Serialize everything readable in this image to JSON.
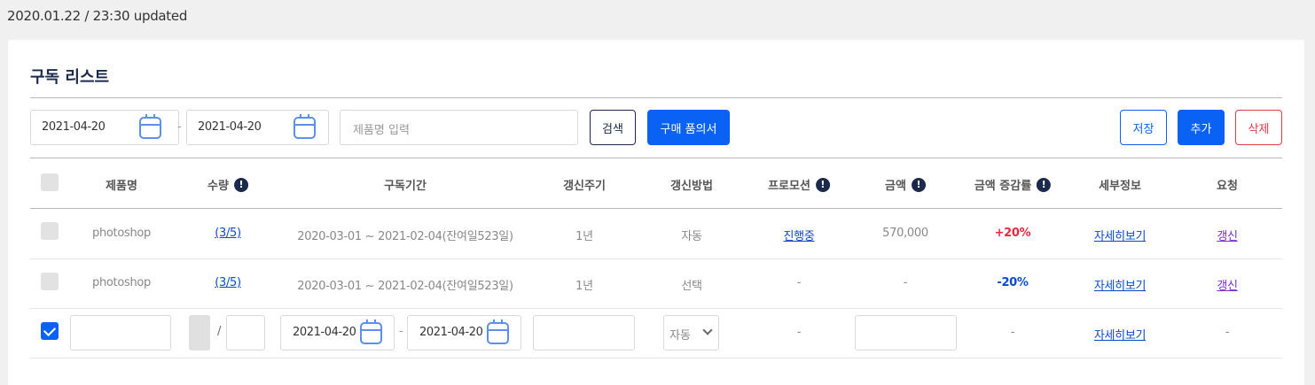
{
  "header": {
    "updated": "2020.01.22 / 23:30 updated"
  },
  "card": {
    "title": "구독 리스트"
  },
  "filters": {
    "start_date": "2021-04-20",
    "end_date": "2021-04-20",
    "separator": "-",
    "product_placeholder": "제품명 입력",
    "search_label": "검색",
    "purchase_label": "구매 품의서",
    "save_label": "저장",
    "add_label": "추가",
    "delete_label": "삭제"
  },
  "columns": [
    "제품명",
    "수량",
    "구독기간",
    "갱신주기",
    "갱신방법",
    "프로모션",
    "금액",
    "금액 증감률",
    "세부정보",
    "요청"
  ],
  "info_icon": "!",
  "rows": [
    {
      "product": "photoshop",
      "quantity": "(3/5)",
      "period": "2020-03-01 ~ 2021-02-04(잔여일523일)",
      "cycle": "1년",
      "method": "자동",
      "promotion": "진행중",
      "amount": "570,000",
      "change": "+20%",
      "details": "자세히보기",
      "request": "갱신"
    },
    {
      "product": "photoshop",
      "quantity": "(3/5)",
      "period": "2020-03-01 ~ 2021-02-04(잔여일523일)",
      "cycle": "1년",
      "method": "선택",
      "promotion": "-",
      "amount": "-",
      "change": "-20%",
      "details": "자세히보기",
      "request": "갱신"
    }
  ],
  "edit_row": {
    "slash": "/",
    "start_date": "2021-04-20",
    "end_date": "2021-04-20",
    "date_sep": "-",
    "method": "자동",
    "promotion": "-",
    "change": "-",
    "details": "자세히보기",
    "request": "-"
  },
  "colors": {
    "primary": "#0a62f5",
    "danger": "#e03a4b",
    "positive": "#e8283d",
    "negative": "#0a49c8",
    "navy": "#1b2a4a"
  }
}
